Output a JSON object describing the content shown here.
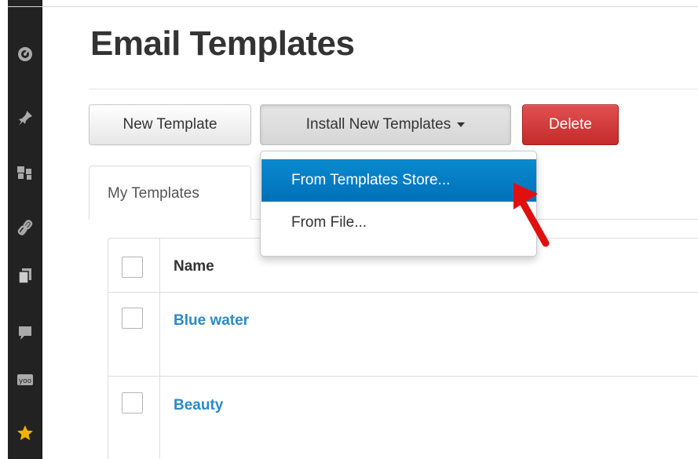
{
  "page": {
    "title": "Email Templates"
  },
  "toolbar": {
    "new_template": "New Template",
    "install_templates": "Install New Templates",
    "delete": "Delete"
  },
  "dropdown": {
    "items": [
      "From Templates Store...",
      "From File..."
    ],
    "active_index": 0
  },
  "tabs": [
    {
      "label": "My Templates"
    }
  ],
  "table": {
    "header": "Name",
    "rows": [
      {
        "name": "Blue water"
      },
      {
        "name": "Beauty"
      }
    ]
  },
  "sidebar": {
    "icons": [
      "dashboard-icon",
      "pin-icon",
      "users-icon",
      "link-icon",
      "pages-icon",
      "comment-icon",
      "yoo-icon",
      "star-icon"
    ]
  },
  "colors": {
    "sidebar": "#222222",
    "primary": "#0a8ad0",
    "danger": "#d03a3a",
    "link": "#2a8ac8",
    "star": "#f0b400"
  }
}
